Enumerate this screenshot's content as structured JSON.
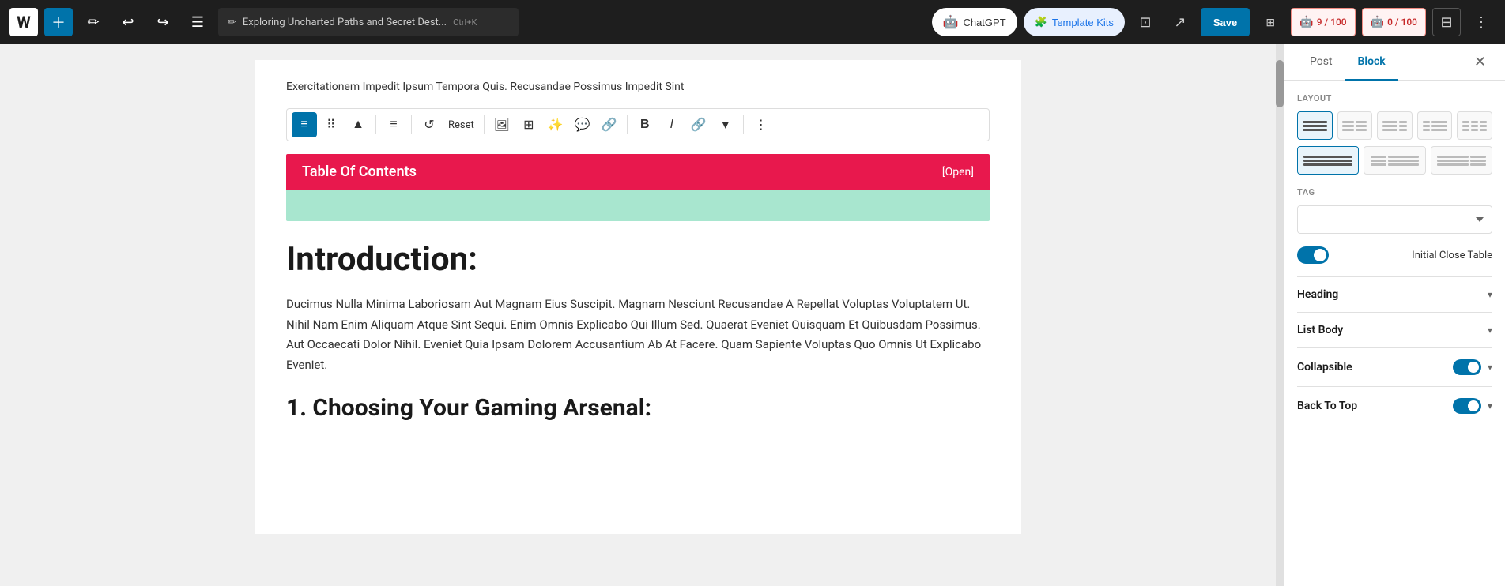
{
  "topbar": {
    "logo": "W",
    "doc_title": "Exploring Uncharted Paths and Secret Dest...",
    "shortcut": "Ctrl+K",
    "chatgpt_label": "ChatGPT",
    "template_kits_label": "Template Kits",
    "save_label": "Save",
    "ai_counter1": "9 / 100",
    "ai_counter2": "0 / 100"
  },
  "editor": {
    "article_header": "Exercitationem Impedit Ipsum Tempora Quis. Recusandae Possimus Impedit Sint",
    "toc_title": "Table Of Contents",
    "toc_open": "[Open]",
    "intro_heading": "Introduction:",
    "body_text": "Ducimus Nulla Minima Laboriosam Aut Magnam Eius Suscipit. Magnam Nesciunt Recusandae A Repellat Voluptas Voluptatem Ut. Nihil Nam Enim Aliquam Atque Sint Sequi. Enim Omnis Explicabo Qui Illum Sed. Quaerat Eveniet Quisquam Et Quibusdam Possimus. Aut Occaecati Dolor Nihil. Eveniet Quia Ipsam Dolorem Accusantium Ab At Facere. Quam Sapiente Voluptas Quo Omnis Ut Explicabo Eveniet.",
    "sub_heading": "1. Choosing Your Gaming Arsenal:",
    "toolbar": {
      "reset_label": "Reset"
    }
  },
  "right_panel": {
    "tab_post": "Post",
    "tab_block": "Block",
    "active_tab": "Block",
    "layout_label": "Layout",
    "tag_label": "TAG",
    "tag_placeholder": "",
    "toggle_label": "Initial Close Table",
    "sections": [
      {
        "title": "Heading",
        "has_toggle": false
      },
      {
        "title": "List Body",
        "has_toggle": false
      },
      {
        "title": "Collapsible",
        "has_toggle": true
      },
      {
        "title": "Back To Top",
        "has_toggle": true
      }
    ]
  }
}
